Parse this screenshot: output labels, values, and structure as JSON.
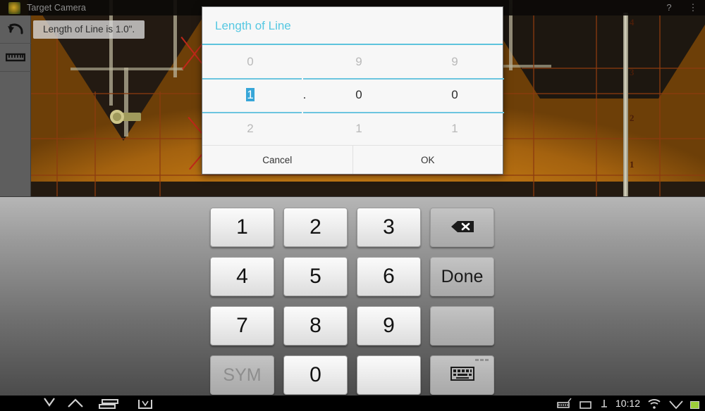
{
  "action_bar": {
    "app_icon": "target-camera-app-icon",
    "title": "Target Camera",
    "help_icon": "question-mark-icon",
    "overflow_icon": "overflow-menu-icon"
  },
  "tool_strip": {
    "items": [
      {
        "name": "undo-tool",
        "icon": "undo-arrow-icon"
      },
      {
        "name": "measure-tool",
        "icon": "ruler-icon"
      }
    ]
  },
  "toast": {
    "message": "Length of Line is 1.0\"."
  },
  "camera": {
    "scale_ticks": [
      "4",
      "3",
      "2",
      "1"
    ],
    "accent_grid_color": "#8c3a10",
    "annotation_color": "#c0271a",
    "background_color": "#c47a14"
  },
  "dialog": {
    "title": "Length of Line",
    "title_color": "#56c8e2",
    "divider_color": "#6cc5df",
    "picker": {
      "rows": {
        "above": [
          "0",
          "9",
          "9"
        ],
        "current": [
          "1",
          "0",
          "0"
        ],
        "below": [
          "2",
          "1",
          "1"
        ]
      },
      "decimal_separator": ".",
      "selected_column": 0,
      "selected_value": "1",
      "selection_highlight_color": "#37a6d8",
      "value": "1.00"
    },
    "buttons": {
      "cancel": "Cancel",
      "ok": "OK"
    }
  },
  "keyboard": {
    "keys": [
      {
        "label": "1",
        "name": "key-1",
        "style": "light"
      },
      {
        "label": "2",
        "name": "key-2",
        "style": "light"
      },
      {
        "label": "3",
        "name": "key-3",
        "style": "light"
      },
      {
        "label": "",
        "name": "key-backspace",
        "style": "dark",
        "icon": "backspace-icon"
      },
      {
        "label": "4",
        "name": "key-4",
        "style": "light"
      },
      {
        "label": "5",
        "name": "key-5",
        "style": "light"
      },
      {
        "label": "6",
        "name": "key-6",
        "style": "light"
      },
      {
        "label": "Done",
        "name": "key-done",
        "style": "dark"
      },
      {
        "label": "7",
        "name": "key-7",
        "style": "light"
      },
      {
        "label": "8",
        "name": "key-8",
        "style": "light"
      },
      {
        "label": "9",
        "name": "key-9",
        "style": "light"
      },
      {
        "label": "",
        "name": "key-blank-right",
        "style": "dark"
      },
      {
        "label": "SYM",
        "name": "key-sym",
        "style": "dark"
      },
      {
        "label": "0",
        "name": "key-0",
        "style": "light"
      },
      {
        "label": "",
        "name": "key-blank-bottom",
        "style": "light"
      },
      {
        "label": "",
        "name": "key-switch-keyboard",
        "style": "dark",
        "icon": "keyboard-icon"
      }
    ]
  },
  "nav_bar": {
    "back_icon": "back-icon",
    "home_icon": "home-icon",
    "recents_icon": "recent-apps-icon",
    "screenshot_icon": "screenshot-icon",
    "keyboard_status_icon": "keyboard-active-icon",
    "sd_icon": "sd-card-icon",
    "download_icon": "download-icon",
    "clock": "10:12",
    "wifi_icon": "wifi-icon",
    "signal_icon": "signal-icon",
    "battery_icon": "battery-icon"
  }
}
